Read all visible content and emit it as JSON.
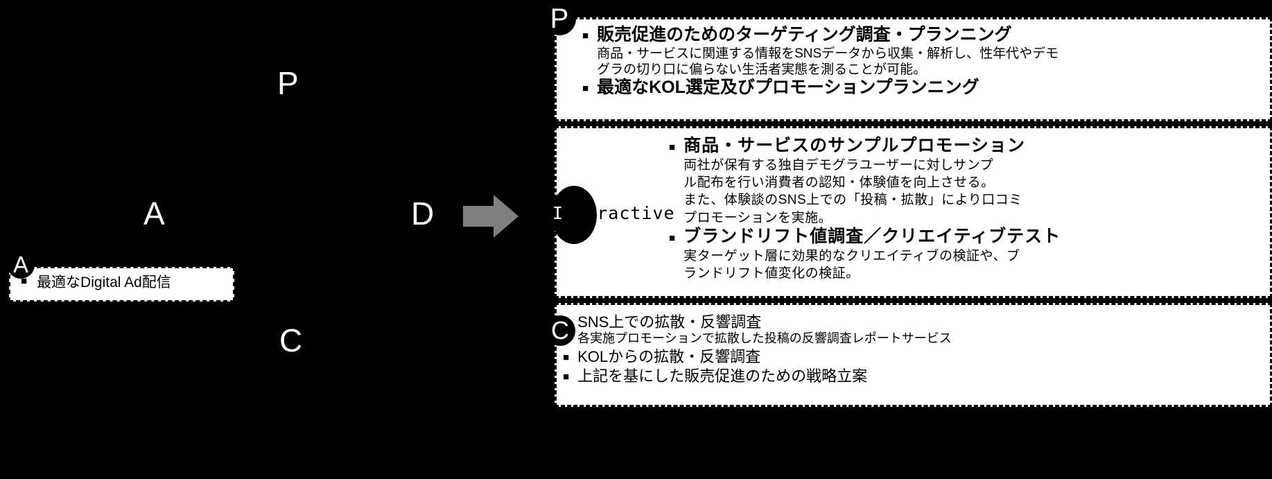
{
  "background_color": "#000000",
  "accent_color": "#ffffff",
  "arrow_color": "#808080",
  "cycle": {
    "letters": [
      {
        "id": "p",
        "label": "P"
      },
      {
        "id": "a",
        "label": "A"
      },
      {
        "id": "d",
        "label": "D"
      },
      {
        "id": "c",
        "label": "C"
      }
    ]
  },
  "panel_a": {
    "badge": "A",
    "items": [
      {
        "marker": "■",
        "title": "最適なDigital Ad配信"
      }
    ]
  },
  "panel_p": {
    "badge": "P",
    "items": [
      {
        "marker": "■",
        "title": "販売促進のためのターゲティング調査・プランニング",
        "desc": "商品・サービスに関連する情報をSNSデータから収集・解析し、性年代やデモ\nグラの切り口に偏らない生活者実態を測ることが可能。"
      },
      {
        "marker": "■",
        "title": "最適なKOL選定及びプロモーションプランニング",
        "desc": ""
      }
    ]
  },
  "panel_interactive": {
    "badge_label_on_black": "I",
    "badge_label_rest": "nteractive",
    "items": [
      {
        "marker": "■",
        "title": "商品・サービスのサンプルプロモーション",
        "desc": "両社が保有する独自デモグラユーザーに対しサンプ\nル配布を行い消費者の認知・体験値を向上させる。\nまた、体験談のSNS上での「投稿・拡散」により口コミ\nプロモーションを実施。"
      },
      {
        "marker": "■",
        "title": "ブランドリフト値調査／クリエイティブテスト",
        "desc": "実ターゲット層に効果的なクリエイティブの検証や、ブ\nランドリフト値変化の検証。"
      }
    ]
  },
  "panel_c": {
    "badge": "C",
    "items": [
      {
        "marker": "■",
        "title": "SNS上での拡散・反響調査",
        "desc": "各実施プロモーションで拡散した投稿の反響調査レポートサービス"
      },
      {
        "marker": "■",
        "title": "KOLからの拡散・反響調査",
        "desc": ""
      },
      {
        "marker": "■",
        "title": "上記を基にした販売促進のための戦略立案",
        "desc": ""
      }
    ]
  }
}
